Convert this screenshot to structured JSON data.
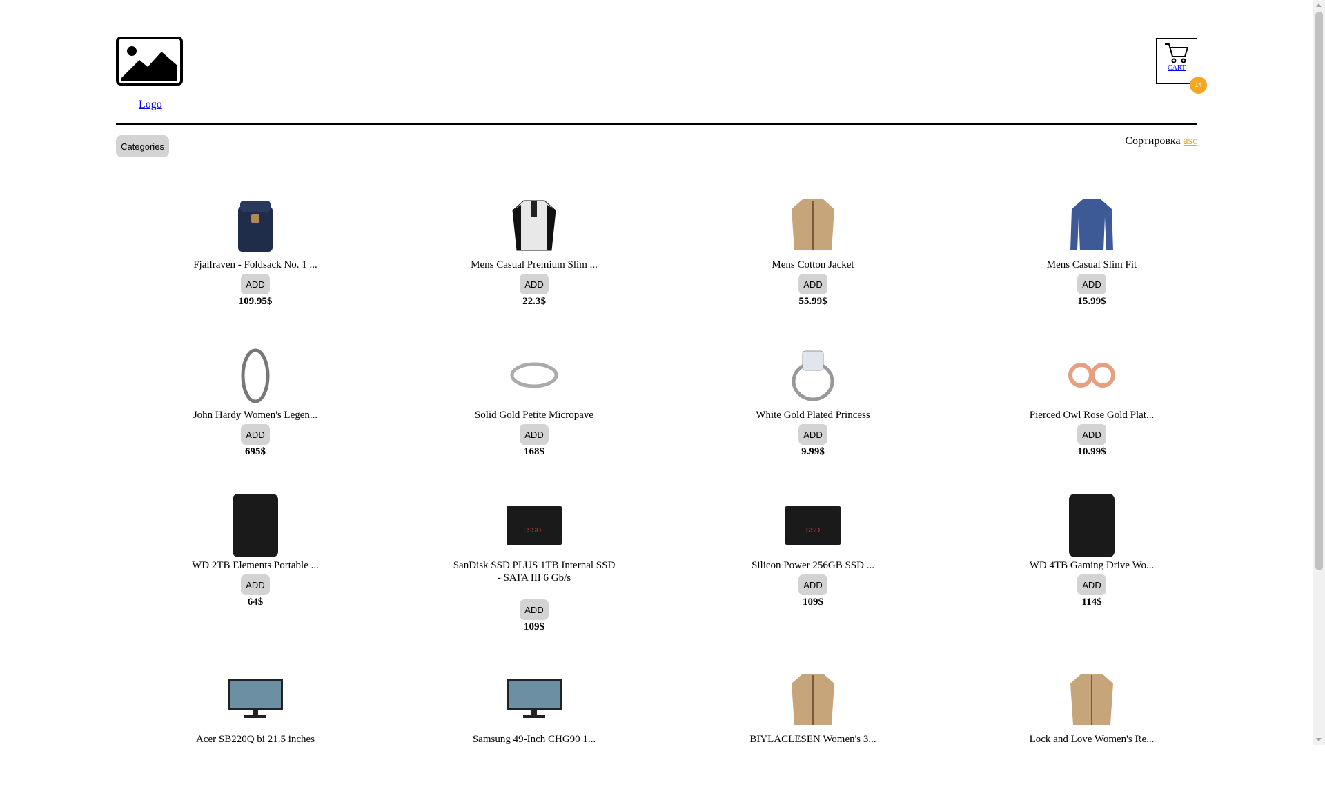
{
  "header": {
    "logo_label": "Logo",
    "cart_label": "CART",
    "cart_count": "14"
  },
  "toolbar": {
    "categories_label": "Categories",
    "sort_label": "Сортировка",
    "sort_value": "asc"
  },
  "products": [
    {
      "title": "Fjallraven - Foldsack No. 1 ...",
      "price": "109.95$",
      "add_label": "ADD",
      "icon": "backpack-image"
    },
    {
      "title": "Mens Casual Premium Slim ...",
      "price": "22.3$",
      "add_label": "ADD",
      "icon": "shirt-image"
    },
    {
      "title": "Mens Cotton Jacket",
      "price": "55.99$",
      "add_label": "ADD",
      "icon": "jacket-image"
    },
    {
      "title": "Mens Casual Slim Fit",
      "price": "15.99$",
      "add_label": "ADD",
      "icon": "longsleeve-image"
    },
    {
      "title": "John Hardy Women's Legen...",
      "price": "695$",
      "add_label": "ADD",
      "icon": "bracelet-image"
    },
    {
      "title": "Solid Gold Petite Micropave",
      "price": "168$",
      "add_label": "ADD",
      "icon": "ring-band-image"
    },
    {
      "title": "White Gold Plated Princess",
      "price": "9.99$",
      "add_label": "ADD",
      "icon": "ring-image"
    },
    {
      "title": "Pierced Owl Rose Gold Plat...",
      "price": "10.99$",
      "add_label": "ADD",
      "icon": "earrings-image"
    },
    {
      "title": "WD 2TB Elements Portable ...",
      "price": "64$",
      "add_label": "ADD",
      "icon": "hdd-image"
    },
    {
      "title": "SanDisk SSD PLUS 1TB Internal SSD - SATA III 6 Gb/s",
      "price": "109$",
      "add_label": "ADD",
      "icon": "ssd-image"
    },
    {
      "title": "Silicon Power 256GB SSD ...",
      "price": "109$",
      "add_label": "ADD",
      "icon": "ssd-image"
    },
    {
      "title": "WD 4TB Gaming Drive Wo...",
      "price": "114$",
      "add_label": "ADD",
      "icon": "hdd-image"
    },
    {
      "title": "Acer SB220Q bi 21.5 inches",
      "price": "",
      "add_label": "",
      "icon": "monitor-image"
    },
    {
      "title": "Samsung 49-Inch CHG90 1...",
      "price": "",
      "add_label": "",
      "icon": "monitor-image"
    },
    {
      "title": "BIYLACLESEN Women's 3...",
      "price": "",
      "add_label": "",
      "icon": "jacket-image"
    },
    {
      "title": "Lock and Love Women's Re...",
      "price": "",
      "add_label": "",
      "icon": "jacket-image"
    }
  ],
  "colors": {
    "accent": "#f5a623",
    "button_bg": "#d3d3d3",
    "link": "#0000ee"
  }
}
